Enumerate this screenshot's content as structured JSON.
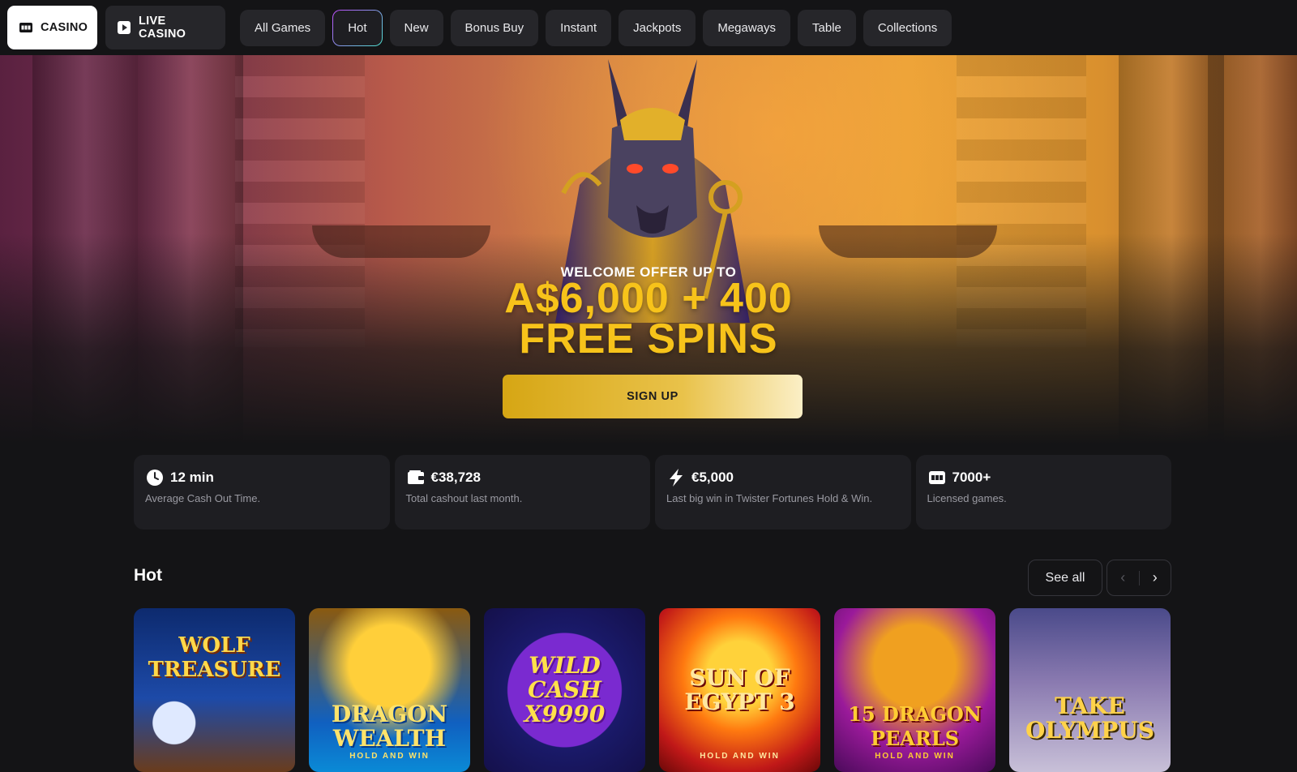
{
  "nav": {
    "modes": [
      {
        "label": "CASINO",
        "icon": "slot-machine-icon",
        "active": true
      },
      {
        "label": "LIVE CASINO",
        "icon": "play-icon",
        "active": false
      }
    ],
    "categories": [
      "All Games",
      "Hot",
      "New",
      "Bonus Buy",
      "Instant",
      "Jackpots",
      "Megaways",
      "Table",
      "Collections"
    ],
    "selected_category": "Hot"
  },
  "hero": {
    "welcome": "WELCOME OFFER UP TO",
    "amount_line1": "A$6,000 + 400",
    "amount_line2": "FREE SPINS",
    "cta": "SIGN UP"
  },
  "stats": [
    {
      "icon": "clock-icon",
      "value": "12 min",
      "label": "Average Cash Out Time."
    },
    {
      "icon": "wallet-icon",
      "value": "€38,728",
      "label": "Total cashout last month."
    },
    {
      "icon": "lightning-icon",
      "value": "€5,000",
      "label": "Last big win in Twister Fortunes Hold & Win."
    },
    {
      "icon": "slot-machine-icon",
      "value": "7000+",
      "label": "Licensed games."
    }
  ],
  "hot": {
    "title": "Hot",
    "see_all": "See all",
    "games": [
      {
        "title": "Wolf Treasure",
        "sub": ""
      },
      {
        "title": "Dragon Wealth",
        "sub": "HOLD AND WIN"
      },
      {
        "title": "Wild Cash x9990",
        "sub": ""
      },
      {
        "title": "Sun of Egypt 3",
        "sub": "HOLD AND WIN"
      },
      {
        "title": "15 Dragon Pearls",
        "sub": "HOLD AND WIN"
      },
      {
        "title": "Take Olympus",
        "sub": ""
      }
    ]
  },
  "colors": {
    "accent_gold": "#f7c31a",
    "page_bg": "#141416",
    "card_bg": "#1e1e22"
  }
}
